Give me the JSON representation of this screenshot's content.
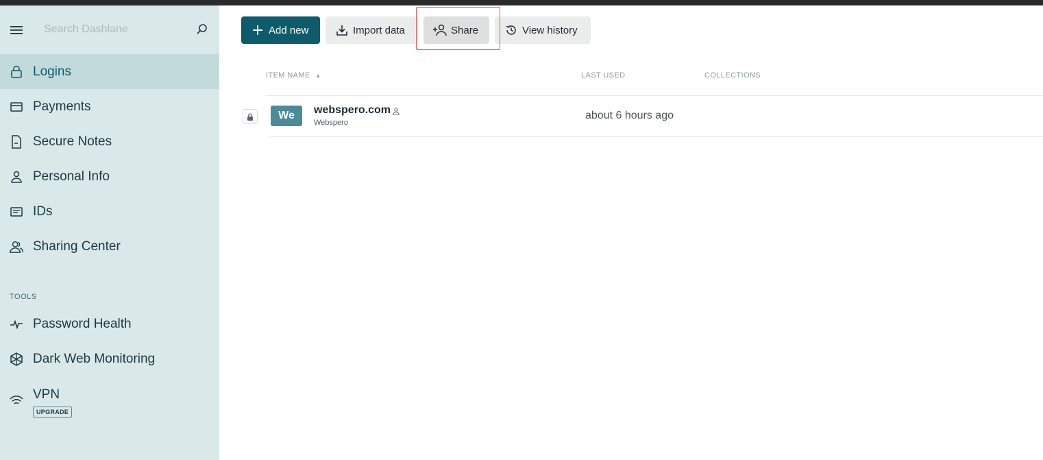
{
  "sidebar": {
    "search_placeholder": "Search Dashlane",
    "items": [
      {
        "label": "Logins",
        "icon": "lock-icon",
        "active": true
      },
      {
        "label": "Payments",
        "icon": "card-icon"
      },
      {
        "label": "Secure Notes",
        "icon": "note-icon"
      },
      {
        "label": "Personal Info",
        "icon": "person-icon"
      },
      {
        "label": "IDs",
        "icon": "id-card-icon"
      },
      {
        "label": "Sharing Center",
        "icon": "people-icon"
      }
    ],
    "tools_label": "TOOLS",
    "tools": [
      {
        "label": "Password Health",
        "icon": "pulse-icon"
      },
      {
        "label": "Dark Web Monitoring",
        "icon": "web-icon"
      },
      {
        "label": "VPN",
        "icon": "wifi-lock-icon",
        "badge": "UPGRADE"
      }
    ]
  },
  "toolbar": {
    "add_new": "Add new",
    "import_data": "Import data",
    "share": "Share",
    "view_history": "View history"
  },
  "table": {
    "headers": {
      "item_name": "ITEM NAME",
      "last_used": "LAST USED",
      "collections": "COLLECTIONS"
    },
    "rows": [
      {
        "avatar": "We",
        "name": "webspero.com",
        "subtitle": "Webspero",
        "last_used": "about 6 hours ago"
      }
    ]
  },
  "colors": {
    "accent": "#0e5c6b",
    "sidebar_bg": "#d9e8e8",
    "sidebar_active": "#c3dadb",
    "avatar_bg": "#4b8a99",
    "highlight": "#e8534f"
  }
}
